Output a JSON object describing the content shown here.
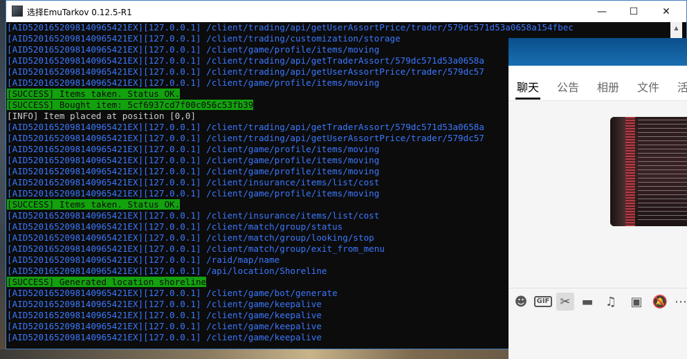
{
  "window": {
    "title": "选择EmuTarkov 0.12.5-R1",
    "minimize_glyph": "—",
    "maximize_glyph": "☐",
    "close_glyph": "✕"
  },
  "console": {
    "lines": [
      {
        "type": "normal",
        "text": "[AID5201652098140965421EX][127.0.0.1] /client/trading/api/getUserAssortPrice/trader/579dc571d53a0658a154fbec"
      },
      {
        "type": "normal",
        "text": "[AID5201652098140965421EX][127.0.0.1] /client/trading/customization/storage"
      },
      {
        "type": "normal",
        "text": "[AID5201652098140965421EX][127.0.0.1] /client/game/profile/items/moving"
      },
      {
        "type": "normal",
        "text": "[AID5201652098140965421EX][127.0.0.1] /client/trading/api/getTraderAssort/579dc571d53a0658a"
      },
      {
        "type": "normal",
        "text": "[AID5201652098140965421EX][127.0.0.1] /client/trading/api/getUserAssortPrice/trader/579dc57"
      },
      {
        "type": "normal",
        "text": "[AID5201652098140965421EX][127.0.0.1] /client/game/profile/items/moving"
      },
      {
        "type": "success",
        "text": "[SUCCESS] Items taken. Status OK."
      },
      {
        "type": "success",
        "text": "[SUCCESS] Bought item: 5cf6937cd7f00c056c53fb39"
      },
      {
        "type": "info",
        "text": "[INFO] Item placed at position [0,0]"
      },
      {
        "type": "normal",
        "text": "[AID5201652098140965421EX][127.0.0.1] /client/trading/api/getTraderAssort/579dc571d53a0658a"
      },
      {
        "type": "normal",
        "text": "[AID5201652098140965421EX][127.0.0.1] /client/trading/api/getUserAssortPrice/trader/579dc57"
      },
      {
        "type": "normal",
        "text": "[AID5201652098140965421EX][127.0.0.1] /client/game/profile/items/moving"
      },
      {
        "type": "normal",
        "text": "[AID5201652098140965421EX][127.0.0.1] /client/game/profile/items/moving"
      },
      {
        "type": "normal",
        "text": "[AID5201652098140965421EX][127.0.0.1] /client/game/profile/items/moving"
      },
      {
        "type": "normal",
        "text": "[AID5201652098140965421EX][127.0.0.1] /client/insurance/items/list/cost"
      },
      {
        "type": "normal",
        "text": "[AID5201652098140965421EX][127.0.0.1] /client/game/profile/items/moving"
      },
      {
        "type": "success",
        "text": "[SUCCESS] Items taken. Status OK."
      },
      {
        "type": "normal",
        "text": "[AID5201652098140965421EX][127.0.0.1] /client/insurance/items/list/cost"
      },
      {
        "type": "normal",
        "text": "[AID5201652098140965421EX][127.0.0.1] /client/match/group/status"
      },
      {
        "type": "normal",
        "text": "[AID5201652098140965421EX][127.0.0.1] /client/match/group/looking/stop"
      },
      {
        "type": "normal",
        "text": "[AID5201652098140965421EX][127.0.0.1] /client/match/group/exit_from_menu"
      },
      {
        "type": "normal",
        "text": "[AID5201652098140965421EX][127.0.0.1] /raid/map/name"
      },
      {
        "type": "normal",
        "text": "[AID5201652098140965421EX][127.0.0.1] /api/location/Shoreline"
      },
      {
        "type": "success",
        "text": "[SUCCESS] Generated location shoreline"
      },
      {
        "type": "normal",
        "text": "[AID5201652098140965421EX][127.0.0.1] /client/game/bot/generate"
      },
      {
        "type": "normal",
        "text": "[AID5201652098140965421EX][127.0.0.1] /client/game/keepalive"
      },
      {
        "type": "normal",
        "text": "[AID5201652098140965421EX][127.0.0.1] /client/game/keepalive"
      },
      {
        "type": "normal",
        "text": "[AID5201652098140965421EX][127.0.0.1] /client/game/keepalive"
      },
      {
        "type": "normal",
        "text": "[AID5201652098140965421EX][127.0.0.1] /client/game/keepalive"
      }
    ],
    "colors": {
      "normal": "#3b78ff",
      "success_bg": "#13a10e",
      "info": "#cccccc",
      "background": "#0c0c0c"
    }
  },
  "chat": {
    "tabs": [
      "聊天",
      "公告",
      "相册",
      "文件",
      "活"
    ],
    "active_tab": "聊天",
    "toolbar": [
      {
        "icon": "emoji-icon",
        "glyph": "☻"
      },
      {
        "icon": "gif-icon",
        "glyph": "GIF"
      },
      {
        "icon": "scissors-icon",
        "glyph": "✂"
      },
      {
        "icon": "folder-icon",
        "glyph": "▬"
      },
      {
        "icon": "music-icon",
        "glyph": "♫"
      },
      {
        "icon": "image-icon",
        "glyph": "▣"
      },
      {
        "icon": "bell-off-icon",
        "glyph": "🔕"
      },
      {
        "icon": "more-icon",
        "glyph": "⋯"
      }
    ]
  }
}
